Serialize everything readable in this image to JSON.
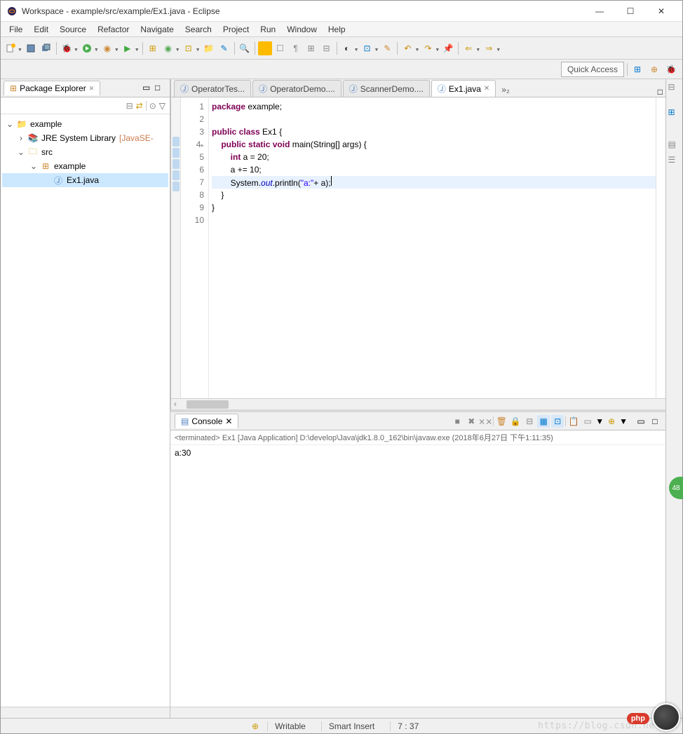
{
  "window": {
    "title": "Workspace - example/src/example/Ex1.java - Eclipse"
  },
  "menu": [
    "File",
    "Edit",
    "Source",
    "Refactor",
    "Navigate",
    "Search",
    "Project",
    "Run",
    "Window",
    "Help"
  ],
  "quick_access": "Quick Access",
  "package_explorer": {
    "title": "Package Explorer",
    "tree": {
      "project": "example",
      "jre": "JRE System Library",
      "jre_suffix": "[JavaSE-",
      "src": "src",
      "pkg": "example",
      "file": "Ex1.java"
    }
  },
  "editor": {
    "tabs": [
      {
        "label": "OperatorTes...",
        "active": false
      },
      {
        "label": "OperatorDemo....",
        "active": false
      },
      {
        "label": "ScannerDemo....",
        "active": false
      },
      {
        "label": "Ex1.java",
        "active": true
      }
    ],
    "overflow": "»₂",
    "code_lines": 10,
    "code": {
      "l1": {
        "pre": "",
        "kw": "package",
        "post": " example;"
      },
      "l2": "",
      "l3": {
        "kw1": "public",
        "kw2": "class",
        "post": " Ex1 {"
      },
      "l4": {
        "indent": "    ",
        "kw1": "public",
        "kw2": "static",
        "kw3": "void",
        "post": " main(String[] args) {"
      },
      "l5": {
        "indent": "        ",
        "kw": "int",
        "post": " a = 20;"
      },
      "l6": "        a += 10;",
      "l7": {
        "indent": "        ",
        "pre": "System.",
        "fld": "out",
        "mid": ".println(",
        "str": "\"a:\"",
        "post": "+ a);"
      },
      "l8": "    }",
      "l9": "}",
      "l10": ""
    }
  },
  "console": {
    "title": "Console",
    "status": "<terminated> Ex1 [Java Application] D:\\develop\\Java\\jdk1.8.0_162\\bin\\javaw.exe (2018年6月27日 下午1:11:35)",
    "output": "a:30"
  },
  "status": {
    "writable": "Writable",
    "insert": "Smart Insert",
    "pos": "7 : 37"
  },
  "watermark": "https://blog.csdn.net/an",
  "badge": "48",
  "php_badge": "php"
}
